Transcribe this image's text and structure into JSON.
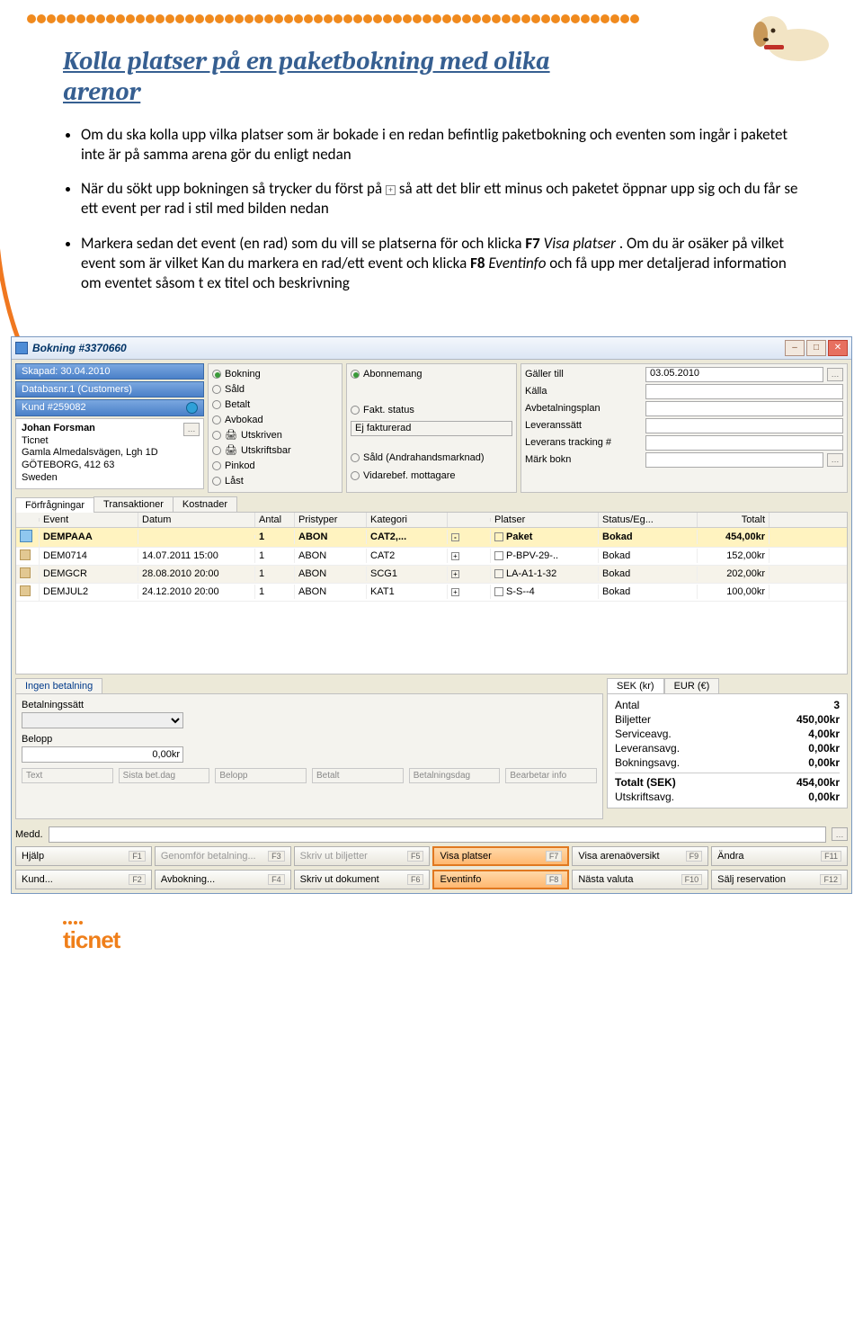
{
  "header": {
    "title_line1": "Kolla platser på en paketbokning med olika",
    "title_line2": "arenor"
  },
  "bullets": {
    "b1": "Om du ska kolla upp vilka platser som är bokade i en redan befintlig paketbokning och eventen som ingår i paketet inte är på samma arena gör du enligt nedan",
    "b2_a": "När du sökt upp bokningen så trycker du först på ",
    "b2_b": " så att det blir ett minus och paketet öppnar upp sig och du får se ett event per rad i stil med bilden nedan",
    "b3_a": "Markera sedan det event (en rad) som du vill se platserna för och klicka ",
    "b3_b": "F7",
    "b3_c": " Visa platser",
    "b3_d": ". Om du är osäker på vilket event som är vilket Kan du markera en rad/ett event och klicka ",
    "b3_e": "F8",
    "b3_f": " Eventinfo",
    "b3_g": " och få upp mer detaljerad information om eventet såsom t ex titel och beskrivning"
  },
  "window": {
    "title": "Bokning #3370660",
    "left": {
      "created": "Skapad: 30.04.2010",
      "db": "Databasnr.1 (Customers)",
      "kund": "Kund #259082",
      "name": "Johan Forsman",
      "org": "Ticnet",
      "addr1": "Gamla Almedalsvägen, Lgh 1D",
      "addr2": "GÖTEBORG, 412 63",
      "country": "Sweden"
    },
    "radios1": {
      "bokning": "Bokning",
      "sald": "Såld",
      "betalt": "Betalt",
      "avbokad": "Avbokad",
      "utskriven": "Utskriven",
      "utskriftsbar": "Utskriftsbar",
      "pinkod": "Pinkod",
      "last": "Låst"
    },
    "radios2": {
      "abonnemang": "Abonnemang",
      "fakt_status": "Fakt. status",
      "ej_fakt": "Ej fakturerad",
      "sald_andra": "Såld (Andrahandsmarknad)",
      "vidare": "Vidarebef. mottagare"
    },
    "rc": {
      "galler": "Gäller till",
      "galler_val": "03.05.2010",
      "kalla": "Källa",
      "avbet": "Avbetalningsplan",
      "levsatt": "Leveranssätt",
      "levtrack": "Leverans tracking #",
      "mark": "Märk bokn"
    },
    "tabs": {
      "t1": "Förfrågningar",
      "t2": "Transaktioner",
      "t3": "Kostnader"
    },
    "gridHead": {
      "event": "Event",
      "datum": "Datum",
      "antal": "Antal",
      "pristyp": "Pristyper",
      "kategori": "Kategori",
      "platser": "Platser",
      "status": "Status/Eg...",
      "totalt": "Totalt"
    },
    "rows": [
      {
        "icon": "cube",
        "event": "DEMPAAA",
        "datum": "",
        "antal": "1",
        "pristyp": "ABON",
        "kategori": "CAT2,...",
        "exp": "-",
        "platser": "Paket",
        "status": "Bokad",
        "totalt": "454,00kr",
        "sel": true
      },
      {
        "icon": "pkg",
        "event": "DEM0714",
        "datum": "14.07.2011 15:00",
        "antal": "1",
        "pristyp": "ABON",
        "kategori": "CAT2",
        "exp": "+",
        "platser": "P-BPV-29-..",
        "status": "Bokad",
        "totalt": "152,00kr"
      },
      {
        "icon": "pkg",
        "event": "DEMGCR",
        "datum": "28.08.2010 20:00",
        "antal": "1",
        "pristyp": "ABON",
        "kategori": "SCG1",
        "exp": "+",
        "platser": "LA-A1-1-32",
        "status": "Bokad",
        "totalt": "202,00kr",
        "alt": true
      },
      {
        "icon": "pkg",
        "event": "DEMJUL2",
        "datum": "24.12.2010 20:00",
        "antal": "1",
        "pristyp": "ABON",
        "kategori": "KAT1",
        "exp": "+",
        "platser": "S-S--4",
        "status": "Bokad",
        "totalt": "100,00kr"
      }
    ],
    "payment": {
      "tab": "Ingen betalning",
      "bet_label": "Betalningssätt",
      "belopp_label": "Belopp",
      "belopp_val": "0,00kr",
      "txt_text": "Text",
      "txt_sista": "Sista bet.dag",
      "txt_belopp": "Belopp",
      "txt_betalt": "Betalt",
      "txt_betdag": "Betalningsdag",
      "txt_bearb": "Bearbetar info"
    },
    "cur": {
      "sek": "SEK (kr)",
      "eur": "EUR (€)"
    },
    "totals": {
      "antal_l": "Antal",
      "antal_v": "3",
      "bil_l": "Biljetter",
      "bil_v": "450,00kr",
      "srv_l": "Serviceavg.",
      "srv_v": "4,00kr",
      "lev_l": "Leveransavg.",
      "lev_v": "0,00kr",
      "bok_l": "Bokningsavg.",
      "bok_v": "0,00kr",
      "tot_l": "Totalt (SEK)",
      "tot_v": "454,00kr",
      "uts_l": "Utskriftsavg.",
      "uts_v": "0,00kr"
    },
    "medd": "Medd.",
    "fn": {
      "f1": "Hjälp",
      "f2": "Kund...",
      "f3": "Genomför betalning...",
      "f4": "Avbokning...",
      "f5": "Skriv ut biljetter",
      "f6": "Skriv ut dokument",
      "f7": "Visa platser",
      "f8": "Eventinfo",
      "f9": "Visa arenaöversikt",
      "f10": "Nästa valuta",
      "f11": "Ändra",
      "f12": "Sälj reservation"
    }
  },
  "logo": "ticnet"
}
